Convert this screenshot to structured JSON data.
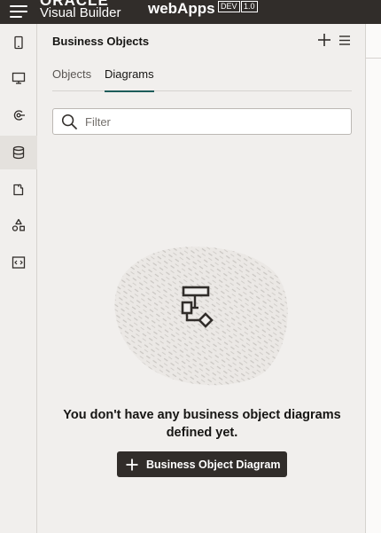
{
  "header": {
    "brand_company": "ORACLE",
    "brand_product": "Visual Builder",
    "app_name": "webApps",
    "badge_env": "DEV",
    "badge_version": "1.0"
  },
  "rail": {
    "items": [
      "mobile-apps",
      "web-apps",
      "services",
      "business-objects",
      "components",
      "processes",
      "source-code"
    ],
    "active": "business-objects"
  },
  "panel": {
    "title": "Business Objects",
    "tabs": [
      {
        "label": "Objects",
        "active": false
      },
      {
        "label": "Diagrams",
        "active": true
      }
    ],
    "filter_placeholder": "Filter",
    "filter_value": "",
    "empty_message": "You don't have any business object diagrams defined yet.",
    "create_button_label": "Business Object Diagram"
  },
  "colors": {
    "header_bg": "#312d2a",
    "accent": "#1d5c5a",
    "button_bg": "#312d2a"
  }
}
